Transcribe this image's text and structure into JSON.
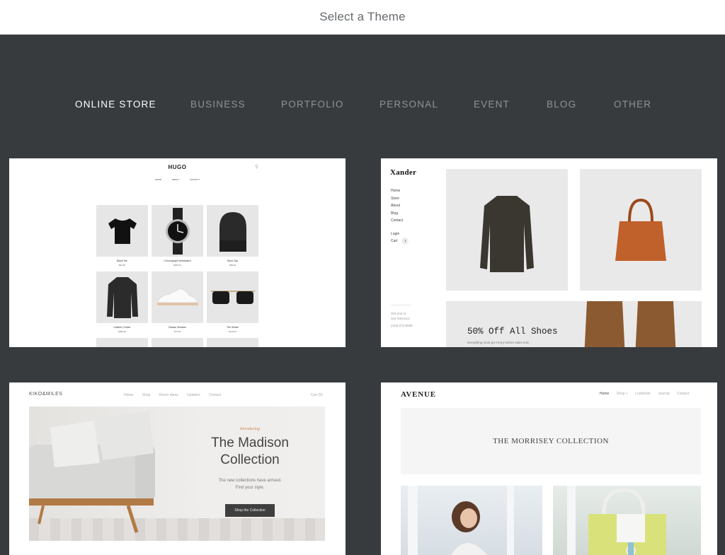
{
  "header": {
    "title": "Select a Theme"
  },
  "categories": [
    {
      "label": "ONLINE STORE",
      "active": true
    },
    {
      "label": "BUSINESS",
      "active": false
    },
    {
      "label": "PORTFOLIO",
      "active": false
    },
    {
      "label": "PERSONAL",
      "active": false
    },
    {
      "label": "EVENT",
      "active": false
    },
    {
      "label": "BLOG",
      "active": false
    },
    {
      "label": "OTHER",
      "active": false
    }
  ],
  "themes": {
    "hugo": {
      "logo": "HUGO",
      "nav": [
        "HOME",
        "ABOUT",
        "CONTACT"
      ],
      "products": [
        {
          "name": "Black Tee",
          "price": "$54.00",
          "icon": "tshirt"
        },
        {
          "name": "Chronograph Wristwatch",
          "price": "$205.00",
          "icon": "watch"
        },
        {
          "name": "Wool Cap",
          "price": "$58.00",
          "icon": "beanie"
        },
        {
          "name": "Leather Cruiser",
          "price": "$390.00",
          "icon": "jacket"
        },
        {
          "name": "Classic Sneaker",
          "price": "$74.00",
          "icon": "sneaker"
        },
        {
          "name": "The Shade",
          "price": "$119.00",
          "icon": "sunglasses"
        }
      ]
    },
    "xander": {
      "logo": "Xander",
      "nav": [
        "Home",
        "Store",
        "About",
        "Blog",
        "Contact"
      ],
      "login": "Login",
      "cart": "Cart",
      "cart_count": "1",
      "address": [
        "303 2nd st",
        "san francisco"
      ],
      "phone": "(415) 672-9565",
      "sale_title": "50% Off All Shoes",
      "sale_sub": "Everything must go! Hurry before sales end."
    },
    "kiko": {
      "logo": "KIKO&MILES",
      "nav": [
        "Home",
        "Shop",
        "Room Ideas",
        "Updates",
        "Contact"
      ],
      "cart": "Cart (0)",
      "intro": "Introducing",
      "title_line1": "The Madison",
      "title_line2": "Collection",
      "desc_line1": "The new collections have arrived.",
      "desc_line2": "Find your style.",
      "button": "Shop the Collection"
    },
    "avenue": {
      "logo": "AVENUE",
      "nav": [
        "Home",
        "Shop +",
        "Lookbook",
        "Journal",
        "Contact"
      ],
      "banner": "THE MORRISEY COLLECTION"
    }
  }
}
